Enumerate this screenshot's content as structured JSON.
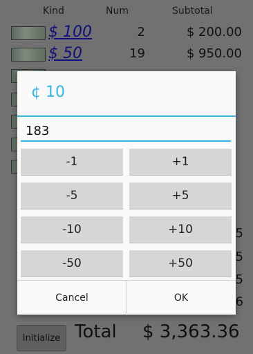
{
  "table": {
    "headers": {
      "kind": "Kind",
      "num": "Num",
      "subtotal": "Subtotal"
    },
    "rows": [
      {
        "kind": "$ 100",
        "num": "2",
        "subtotal": "$ 200.00"
      },
      {
        "kind": "$ 50",
        "num": "19",
        "subtotal": "$ 950.00"
      }
    ],
    "hidden_digits": [
      "5",
      "5",
      "5",
      "6"
    ]
  },
  "footer": {
    "initialize_label": "Initialize",
    "total_label": "Total",
    "total_value": "$ 3,363.36"
  },
  "dialog": {
    "title": "¢ 10",
    "input_value": "183",
    "buttons": {
      "minus1": "-1",
      "plus1": "+1",
      "minus5": "-5",
      "plus5": "+5",
      "minus10": "-10",
      "plus10": "+10",
      "minus50": "-50",
      "plus50": "+50"
    },
    "cancel_label": "Cancel",
    "ok_label": "OK"
  },
  "colors": {
    "accent": "#33b5e5",
    "overlay": "#717171",
    "button": "#d6d6d6"
  }
}
